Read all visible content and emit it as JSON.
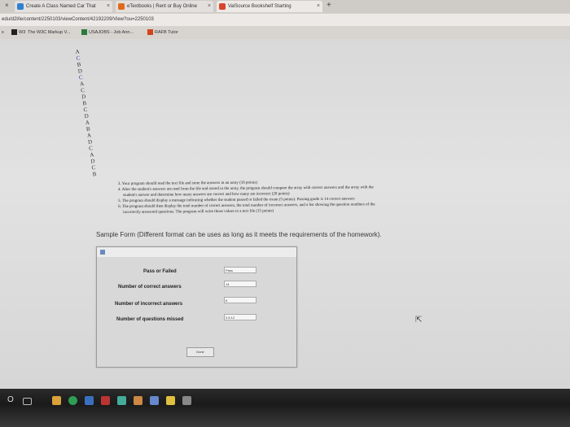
{
  "browser": {
    "close_glyph": "×",
    "tabs": [
      {
        "label": "Create A Class Named Car That",
        "icon": "tab-favicon-icon",
        "color": "#2f7fd0"
      },
      {
        "label": "eTextbooks | Rent or Buy Online",
        "icon": "tab-favicon-icon",
        "color": "#e06a1b"
      },
      {
        "label": "ValSource Bookshelf Starting",
        "icon": "tab-favicon-icon",
        "color": "#d8432c"
      }
    ],
    "tab_close": "×",
    "new_tab": "+",
    "address": "edu/d2l/le/content/2250103/viewContent/42192209/View?ou=2250103",
    "bookmarks": [
      {
        "label": "W3",
        "color": "#222"
      },
      {
        "label": "The W3C Markup V...",
        "color": "#777"
      },
      {
        "label": "USAJOBS - Job Ann...",
        "color": "#2a7a3a"
      },
      {
        "label": "RAFB Tutor",
        "color": "#d0451b"
      }
    ],
    "bookmarks_prefix": "x"
  },
  "page": {
    "answer_letters": [
      "A",
      "C",
      "B",
      "D",
      "C",
      "A",
      "C",
      "D",
      "B",
      "C",
      "D",
      "A",
      "B",
      "A",
      "D",
      "C",
      "A",
      "D",
      "C",
      "B"
    ],
    "instructions": [
      "3. Your program should read the text file and store the answers in an array (10 points)",
      "4. After the student's answers are read from the file and stored in the array, the program should compare the array with correct answers and the array with the",
      "student's answer and determine how many answers are correct and how many are incorrect (20 points)",
      "5. The program should display a message indicating whether the student passed or failed the exam (5 points). Passing grade is 14 correct answers",
      "6. The program should then display the total number of correct answers, the total number of incorrect answers, and a list showing the question numbers of the",
      "incorrectly answered questions. The program will write those values to a text file (15 points)"
    ],
    "sample_heading": "Sample Form (Different format can be uses as long as it meets the requirements of the homework)."
  },
  "form": {
    "rows": [
      {
        "label": "Pass or Failed",
        "value": "Pass"
      },
      {
        "label": "Number of correct answers",
        "value": "14"
      },
      {
        "label": "Number of incorrect answers",
        "value": "6"
      },
      {
        "label": "Number of questions missed",
        "value": "3 8 12"
      }
    ],
    "button_label": "Done"
  },
  "taskbar": {
    "start_glyph": "O",
    "icons": [
      {
        "name": "task-view-icon",
        "color": "#9aa"
      },
      {
        "name": "file-explorer-icon",
        "color": "#d9a23a"
      },
      {
        "name": "chrome-icon",
        "color": "#2f9e55"
      },
      {
        "name": "app-icon-1",
        "color": "#3a6fc0"
      },
      {
        "name": "app-icon-2",
        "color": "#b33"
      },
      {
        "name": "app-icon-3",
        "color": "#4a9"
      },
      {
        "name": "app-icon-4",
        "color": "#c84"
      },
      {
        "name": "app-icon-5",
        "color": "#68c"
      },
      {
        "name": "app-icon-6",
        "color": "#e0c040"
      },
      {
        "name": "app-icon-7",
        "color": "#888"
      }
    ]
  }
}
